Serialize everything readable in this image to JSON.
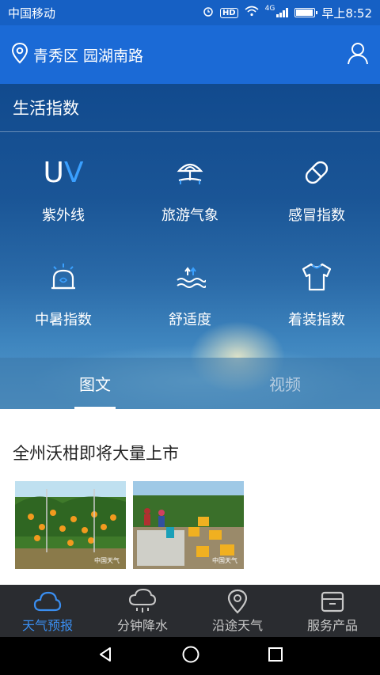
{
  "status_bar": {
    "carrier": "中国移动",
    "time": "早上8:52",
    "network": "4G"
  },
  "location": {
    "text": "青秀区 园湖南路",
    "pin_icon": "location-pin-icon",
    "profile_icon": "user-icon"
  },
  "section": {
    "title": "生活指数"
  },
  "indices": [
    {
      "label": "紫外线",
      "icon": "uv-icon",
      "icon_text": {
        "u": "U",
        "v": "V"
      }
    },
    {
      "label": "旅游气象",
      "icon": "beach-umbrella-icon"
    },
    {
      "label": "感冒指数",
      "icon": "pill-icon"
    },
    {
      "label": "中暑指数",
      "icon": "alarm-light-icon"
    },
    {
      "label": "舒适度",
      "icon": "comfort-waves-icon"
    },
    {
      "label": "着装指数",
      "icon": "tshirt-icon"
    }
  ],
  "tabs": [
    {
      "label": "图文",
      "active": true
    },
    {
      "label": "视频",
      "active": false
    }
  ],
  "article": {
    "headline": "全州沃柑即将大量上市",
    "watermark": "中国天气"
  },
  "bottom_nav": [
    {
      "label": "天气预报",
      "icon": "cloud-icon",
      "active": true
    },
    {
      "label": "分钟降水",
      "icon": "rain-cloud-icon",
      "active": false
    },
    {
      "label": "沿途天气",
      "icon": "route-pin-icon",
      "active": false
    },
    {
      "label": "服务产品",
      "icon": "box-icon",
      "active": false
    }
  ],
  "colors": {
    "accent": "#3a8ef0",
    "header_blue": "#1b6ad6",
    "statusbar_blue": "#1660c4",
    "nav_bg": "#2a2c30"
  }
}
